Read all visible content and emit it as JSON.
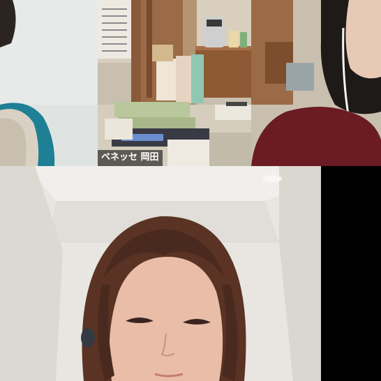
{
  "meeting": {
    "participants": [
      {
        "id": "p1",
        "display_name": ""
      },
      {
        "id": "p2",
        "display_name": "ベネッセ 岡田"
      },
      {
        "id": "p3",
        "display_name": ""
      },
      {
        "id": "p4",
        "display_name": ""
      }
    ]
  },
  "colors": {
    "background": "#000000",
    "label_bg": "rgba(20,20,20,0.62)",
    "label_text": "#ffffff"
  }
}
